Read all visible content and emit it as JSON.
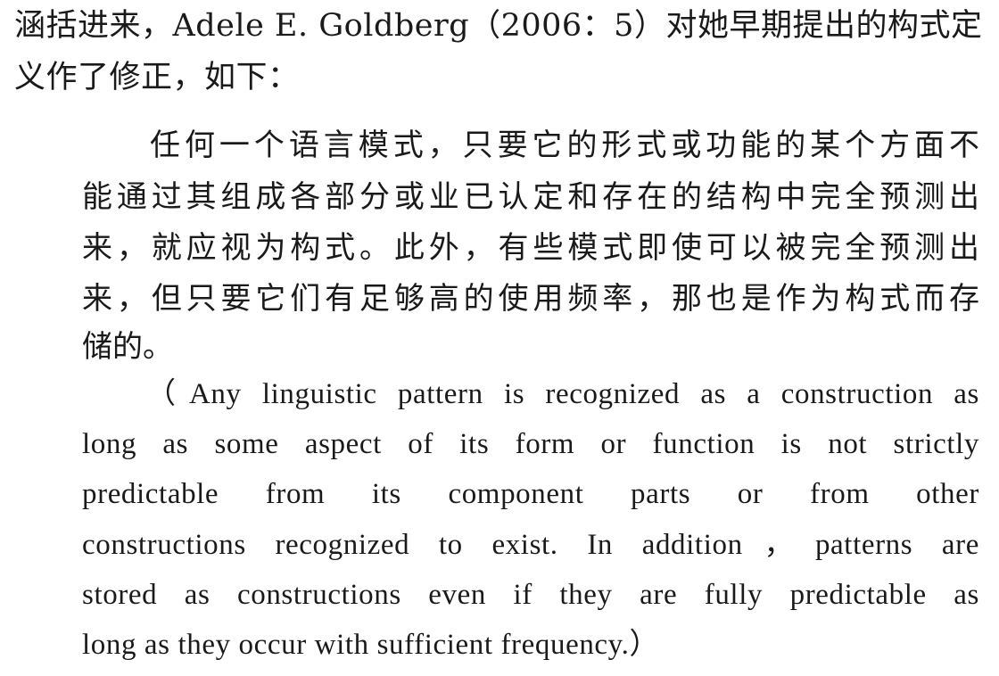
{
  "intro": {
    "line1": "涵括进来，Adele E. Goldberg（2006：5）对她早期提出的构式定",
    "line2": "义作了修正，如下："
  },
  "quote_zh": {
    "line1": "任何一个语言模式，只要它的形式或功能的某个方面不",
    "line2": "能通过其组成各部分或业已认定和存在的结构中完全预测出",
    "line3": "来，就应视为构式。此外，有些模式即使可以被完全预测出",
    "line4": "来，但只要它们有足够高的使用频率，那也是作为构式而存",
    "line5": "储的。"
  },
  "quote_en": {
    "line1": "（Any linguistic pattern is recognized as a construction as",
    "line2": "long as some aspect of its form or function is not strictly",
    "line3": "predictable from its component parts or from other",
    "line4": "constructions recognized to exist. In addition，patterns are",
    "line5": "stored as constructions even if they are fully predictable as",
    "line6": "long as they occur with sufficient frequency.）"
  }
}
